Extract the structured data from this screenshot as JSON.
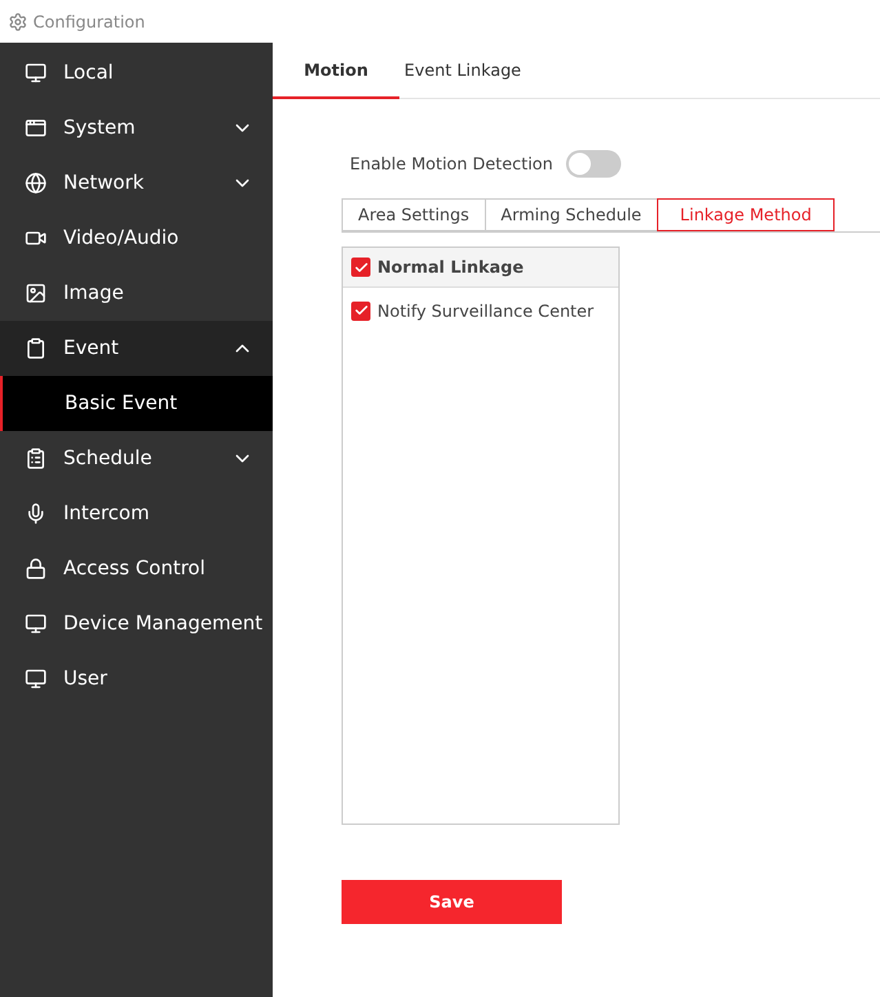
{
  "header": {
    "title": "Configuration"
  },
  "sidebar": {
    "items": [
      {
        "label": "Local",
        "selected": false
      },
      {
        "label": "System",
        "selected": false,
        "expanded": false
      },
      {
        "label": "Network",
        "selected": false,
        "expanded": false
      },
      {
        "label": "Video/Audio",
        "selected": false
      },
      {
        "label": "Image",
        "selected": false
      },
      {
        "label": "Event",
        "selected": true,
        "expanded": true,
        "children": [
          {
            "label": "Basic Event",
            "selected": true
          }
        ]
      },
      {
        "label": "Schedule",
        "selected": false,
        "expanded": false
      },
      {
        "label": "Intercom",
        "selected": false
      },
      {
        "label": "Access Control",
        "selected": false
      },
      {
        "label": "Device Management",
        "selected": false
      },
      {
        "label": "User",
        "selected": false
      }
    ]
  },
  "tabs": [
    {
      "label": "Motion",
      "selected": true
    },
    {
      "label": "Event Linkage",
      "selected": false
    }
  ],
  "motion_toggle": {
    "label": "Enable Motion Detection",
    "on": false
  },
  "sub_tabs": [
    {
      "label": "Area Settings",
      "selected": false
    },
    {
      "label": "Arming Schedule",
      "selected": false
    },
    {
      "label": "Linkage Method",
      "selected": true
    }
  ],
  "linkage": {
    "group": {
      "label": "Normal Linkage",
      "checked": true
    },
    "items": [
      {
        "label": "Notify Surveillance Center",
        "checked": true
      }
    ]
  },
  "save_button": "Save"
}
